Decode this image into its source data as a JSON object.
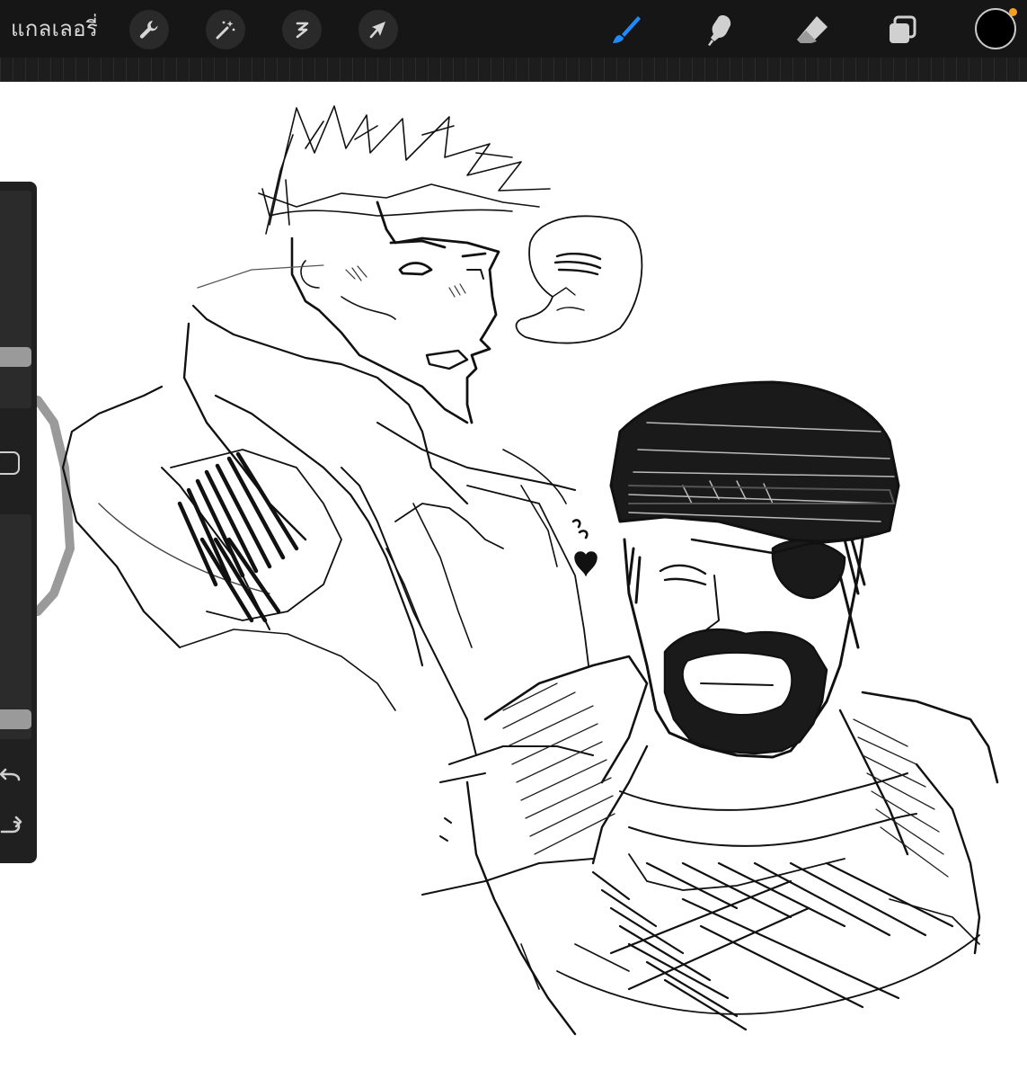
{
  "app": {
    "gallery_label": "แกลเลอรี่"
  },
  "toolbar": {
    "left_tools": [
      {
        "name": "actions",
        "icon": "wrench-icon"
      },
      {
        "name": "adjustments",
        "icon": "magic-wand-icon"
      },
      {
        "name": "selection",
        "icon": "s-curve-icon"
      },
      {
        "name": "transform",
        "icon": "arrow-cursor-icon"
      }
    ],
    "right_tools": [
      {
        "name": "brush",
        "icon": "brush-icon",
        "active": true
      },
      {
        "name": "smudge",
        "icon": "smudge-finger-icon",
        "active": false
      },
      {
        "name": "eraser",
        "icon": "eraser-icon",
        "active": false
      },
      {
        "name": "layers",
        "icon": "layers-icon",
        "active": false
      }
    ],
    "current_color": "#000000",
    "color_indicator": "#f5a11f",
    "active_accent": "#1f8bff"
  },
  "sidebar": {
    "brush_size_level": 0.21,
    "brush_opacity_level": 0.05,
    "undo_icon": "undo-arrow-icon",
    "redo_icon": "redo-arrow-icon"
  },
  "canvas": {
    "artwork": "pencil-sketch"
  }
}
